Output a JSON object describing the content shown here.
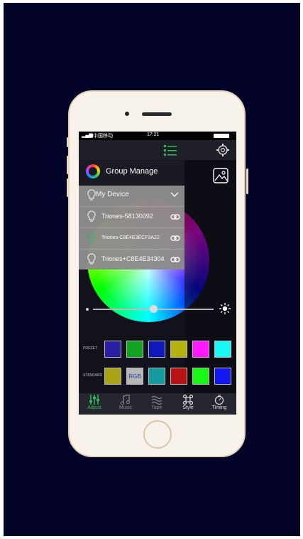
{
  "status": {
    "carrier": "中国移动",
    "time": "17:21"
  },
  "menu": {
    "header": "Group Manage",
    "my_device": "My Device",
    "devices": [
      {
        "name": "Triones-58130092"
      },
      {
        "name": "Triones-C8E4E3ECF3A22"
      },
      {
        "name": "Triones+C8E4E34304"
      }
    ]
  },
  "colors": {
    "preset_label": "PRESET",
    "standard_label": "STANDARD",
    "preset": [
      "#2a1fa0",
      "#11a321",
      "#1019b8",
      "#b6b10f",
      "#ff19ff",
      "#19f8f4"
    ],
    "standard": [
      "#a9a417",
      "#b7b7b7",
      "#169c9f",
      "#b71313",
      "#18f718",
      "#1418f0"
    ],
    "rgb_label": "RGB"
  },
  "brightness_fraction": 0.5,
  "tabs": [
    {
      "label": "Adjust",
      "active": true
    },
    {
      "label": "Music",
      "active": false
    },
    {
      "label": "Tape",
      "active": false
    },
    {
      "label": "Style",
      "active": false
    },
    {
      "label": "Timing",
      "active": false
    }
  ],
  "accent": "#2fbd5a"
}
